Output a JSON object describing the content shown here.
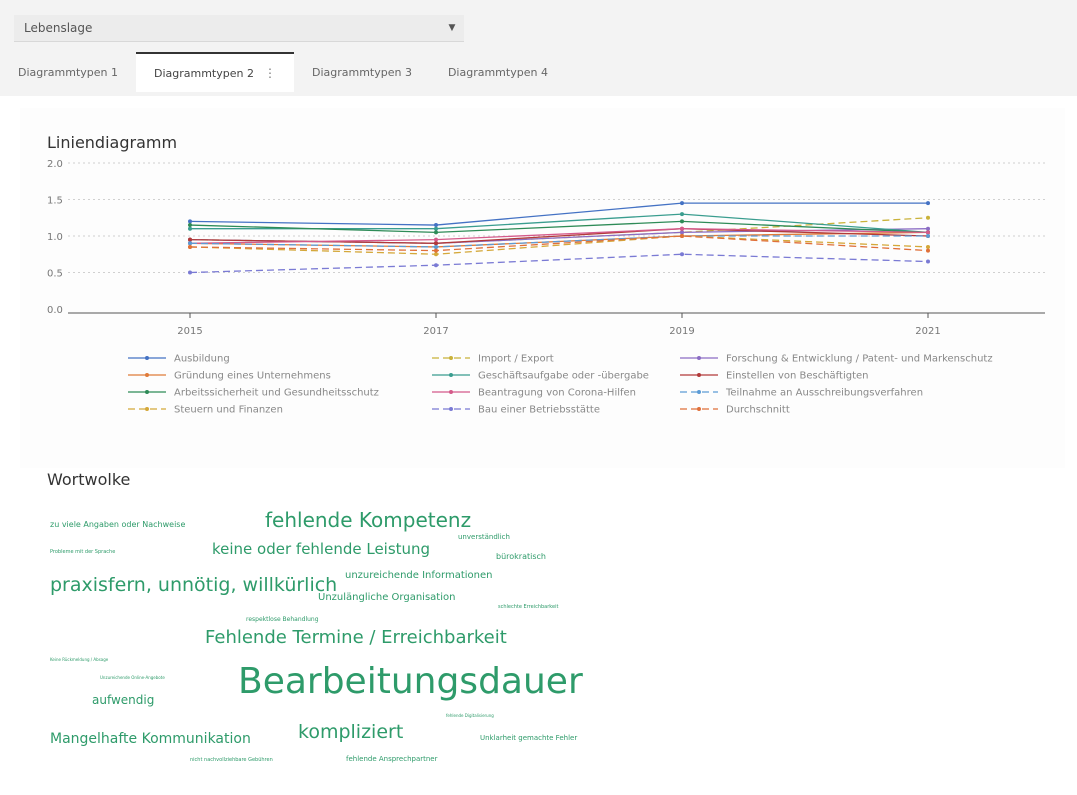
{
  "filter": {
    "value": "Lebenslage"
  },
  "tabs": [
    {
      "label": "Diagrammtypen 1"
    },
    {
      "label": "Diagrammtypen 2"
    },
    {
      "label": "Diagrammtypen 3"
    },
    {
      "label": "Diagrammtypen 4"
    }
  ],
  "active_tab_menu": "⋮",
  "line_section_title": "Liniendiagramm",
  "cloud_section_title": "Wortwolke",
  "colors": {
    "accent": "#2e9b6a",
    "topbar": "#f3f3f3"
  },
  "chart_data": [
    {
      "type": "line",
      "title": "Liniendiagramm",
      "x": [
        "2015",
        "2017",
        "2019",
        "2021"
      ],
      "ylim": [
        0.0,
        2.0
      ],
      "yticks": [
        "0.0",
        "0.5",
        "1.0",
        "1.5",
        "2.0"
      ],
      "grid": true,
      "legend_position": "bottom",
      "series": [
        {
          "name": "Ausbildung",
          "color": "#4472c4",
          "dash": false,
          "values": [
            1.2,
            1.15,
            1.45,
            1.45
          ]
        },
        {
          "name": "Import / Export",
          "color": "#c9b23a",
          "dash": true,
          "values": [
            0.95,
            0.9,
            1.05,
            1.25
          ]
        },
        {
          "name": "Forschung & Entwicklung / Patent- und Markenschutz",
          "color": "#8b6cc4",
          "dash": false,
          "values": [
            0.95,
            0.9,
            1.05,
            1.1
          ]
        },
        {
          "name": "Gründung eines Unternehmens",
          "color": "#e07b39",
          "dash": false,
          "values": [
            0.9,
            0.85,
            1.0,
            1.05
          ]
        },
        {
          "name": "Geschäftsaufgabe oder -übergabe",
          "color": "#3a9d8f",
          "dash": false,
          "values": [
            1.1,
            1.1,
            1.3,
            1.05
          ]
        },
        {
          "name": "Einstellen von Beschäftigten",
          "color": "#b23a3a",
          "dash": false,
          "values": [
            0.95,
            0.9,
            1.1,
            1.0
          ]
        },
        {
          "name": "Arbeitssicherheit und Gesundheitsschutz",
          "color": "#2e8b57",
          "dash": false,
          "values": [
            1.15,
            1.05,
            1.2,
            1.05
          ]
        },
        {
          "name": "Beantragung von Corona-Hilfen",
          "color": "#d45a8a",
          "dash": false,
          "values": [
            0.9,
            0.95,
            1.1,
            1.05
          ]
        },
        {
          "name": "Teilnahme an Ausschreibungsverfahren",
          "color": "#5b9bd5",
          "dash": true,
          "values": [
            0.9,
            0.85,
            1.0,
            1.0
          ]
        },
        {
          "name": "Steuern und Finanzen",
          "color": "#d4a83a",
          "dash": true,
          "values": [
            0.85,
            0.75,
            1.0,
            0.85
          ]
        },
        {
          "name": "Bau einer Betriebsstätte",
          "color": "#7a7ad4",
          "dash": true,
          "values": [
            0.5,
            0.6,
            0.75,
            0.65
          ]
        },
        {
          "name": "Durchschnitt",
          "color": "#e0703a",
          "dash": true,
          "values": [
            0.85,
            0.8,
            1.0,
            0.8
          ]
        }
      ]
    }
  ],
  "word_cloud": [
    {
      "text": "zu viele Angaben oder Nachweise",
      "size": 8
    },
    {
      "text": "fehlende Kompetenz",
      "size": 20
    },
    {
      "text": "unverständlich",
      "size": 7
    },
    {
      "text": "Probleme mit der Sprache",
      "size": 5
    },
    {
      "text": "keine oder fehlende Leistung",
      "size": 15
    },
    {
      "text": "bürokratisch",
      "size": 8
    },
    {
      "text": "praxisfern, unnötig, willkürlich",
      "size": 19
    },
    {
      "text": "unzureichende Informationen",
      "size": 10
    },
    {
      "text": "Unzulängliche Organisation",
      "size": 10
    },
    {
      "text": "schlechte Erreichbarkeit",
      "size": 5
    },
    {
      "text": "respektlose Behandlung",
      "size": 6
    },
    {
      "text": "Fehlende Termine / Erreichbarkeit",
      "size": 18
    },
    {
      "text": "Keine Rückmeldung / Absage",
      "size": 4
    },
    {
      "text": "Unzureichende Online-Angebote",
      "size": 4
    },
    {
      "text": "Bearbeitungsdauer",
      "size": 36
    },
    {
      "text": "aufwendig",
      "size": 12
    },
    {
      "text": "fehlende Digitalisierung",
      "size": 4
    },
    {
      "text": "Mangelhafte Kommunikation",
      "size": 14
    },
    {
      "text": "kompliziert",
      "size": 19
    },
    {
      "text": "Unklarheit gemachte Fehler",
      "size": 7
    },
    {
      "text": "fehlende Ansprechpartner",
      "size": 7
    },
    {
      "text": "nicht nachvollziehbare Gebühren",
      "size": 5
    }
  ]
}
